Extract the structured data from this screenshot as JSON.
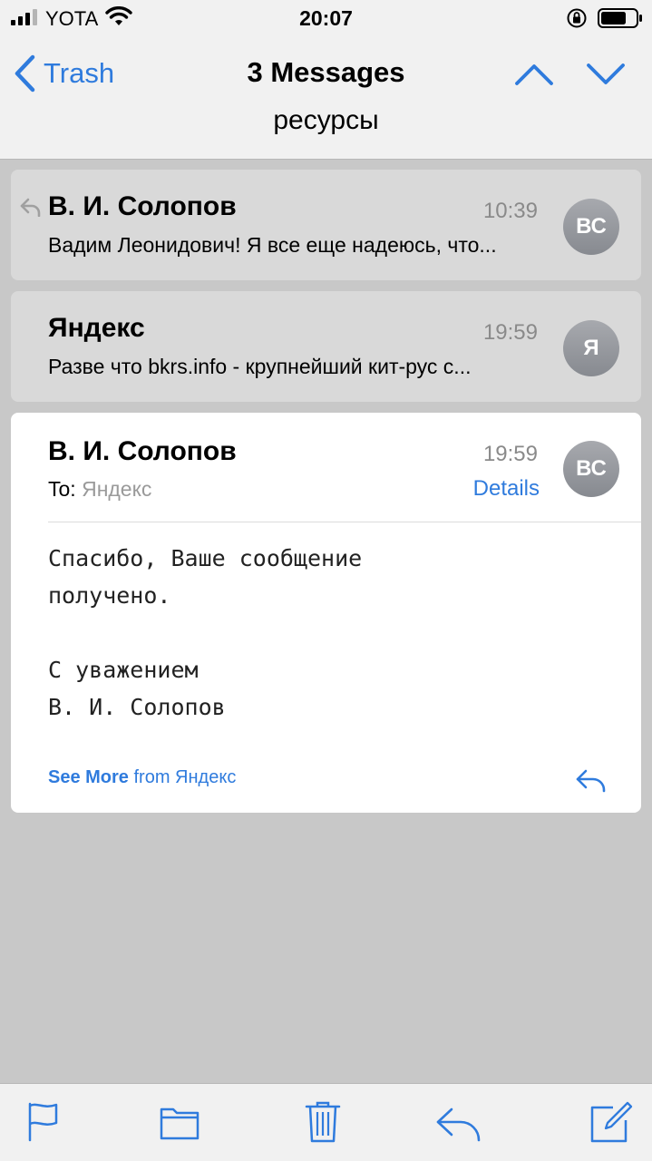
{
  "status_bar": {
    "carrier": "YOTA",
    "time": "20:07"
  },
  "nav": {
    "back_label": "Trash",
    "title": "3 Messages",
    "subtitle": "ресурсы"
  },
  "messages": [
    {
      "sender": "В. И. Солопов",
      "time": "10:39",
      "preview": "Вадим Леонидович! Я все еще надеюсь, что...",
      "avatar": "ВС",
      "replied": true
    },
    {
      "sender": "Яндекс",
      "time": "19:59",
      "preview": "Разве что bkrs.info - крупнейший кит-рус с...",
      "avatar": "Я",
      "replied": false
    },
    {
      "sender": "В. И. Солопов",
      "time": "19:59",
      "avatar": "ВС",
      "to_label": "To:",
      "to_value": "Яндекс",
      "details_label": "Details",
      "body_lines": [
        "Спасибо, Ваше сообщение",
        "получено.",
        "",
        "С уважением",
        "В. И. Солопов"
      ],
      "see_more_label": "See More",
      "see_more_from": "from Яндекс"
    }
  ],
  "accent_color": "#2f7bdd",
  "toolbar": {
    "icons": [
      "flag-icon",
      "folder-icon",
      "trash-icon",
      "reply-icon",
      "compose-icon"
    ]
  }
}
